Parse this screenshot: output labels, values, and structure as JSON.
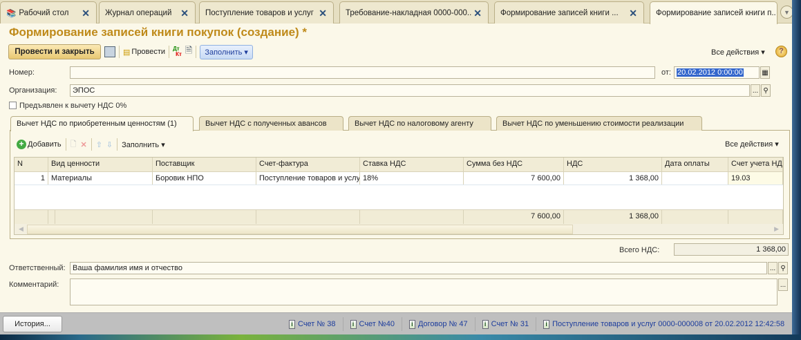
{
  "window_tabs": [
    {
      "label": "Рабочий стол",
      "icon": "desktop-icon"
    },
    {
      "label": "Журнал операций"
    },
    {
      "label": "Поступление товаров и услуг"
    },
    {
      "label": "Требование-накладная 0000-000.."
    },
    {
      "label": "Формирование записей книги ..."
    },
    {
      "label": "Формирование записей книги п..",
      "active": true
    }
  ],
  "title": "Формирование записей книги покупок (создание) *",
  "toolbar": {
    "post_close": "Провести и закрыть",
    "post": "Провести",
    "fill": "Заполнить",
    "all_actions": "Все действия",
    "dtkt_top": "Дт",
    "dtkt_bottom": "Кт",
    "help": "?"
  },
  "fields": {
    "number_label": "Номер:",
    "number_value": "",
    "date_label": "от:",
    "date_value": "20.02.2012  0:00:00",
    "org_label": "Организация:",
    "org_value": "ЭПОС",
    "checkbox_label": "Предъявлен к вычету НДС 0%",
    "checkbox_checked": false,
    "total_label": "Всего НДС:",
    "total_value": "1 368,00",
    "responsible_label": "Ответственный:",
    "responsible_value": "Ваша фамилия имя и отчество",
    "comment_label": "Комментарий:",
    "comment_value": "",
    "ellipsis": "...",
    "search": "🔍"
  },
  "form_tabs": [
    "Вычет НДС по приобретенным ценностям (1)",
    "Вычет НДС с полученных авансов",
    "Вычет НДС по налоговому агенту",
    "Вычет НДС по уменьшению стоимости реализации"
  ],
  "grid_toolbar": {
    "add": "Добавить",
    "fill": "Заполнить",
    "all_actions": "Все действия"
  },
  "grid": {
    "columns": [
      "N",
      "Вид ценности",
      "Поставщик",
      "Счет-фактура",
      "Ставка НДС",
      "Сумма без НДС",
      "НДС",
      "Дата оплаты",
      "Счет учета НД"
    ],
    "rows": [
      [
        "1",
        "Материалы",
        "Боровик НПО",
        "Поступление товаров и услуг",
        "18%",
        "7 600,00",
        "1 368,00",
        "",
        "19.03"
      ]
    ],
    "totals": [
      "",
      "",
      "",
      "",
      "",
      "7 600,00",
      "1 368,00",
      "",
      ""
    ]
  },
  "status": {
    "history": "История...",
    "links": [
      "Счет № 38",
      "Счет №40",
      "Договор № 47",
      "Счет № 31",
      "Поступление товаров и услуг 0000-000008 от 20.02.2012 12:42:58"
    ]
  },
  "colors": {
    "title": "#bf8a1a",
    "background": "#fbf8e9",
    "link": "#1c3c9c"
  }
}
